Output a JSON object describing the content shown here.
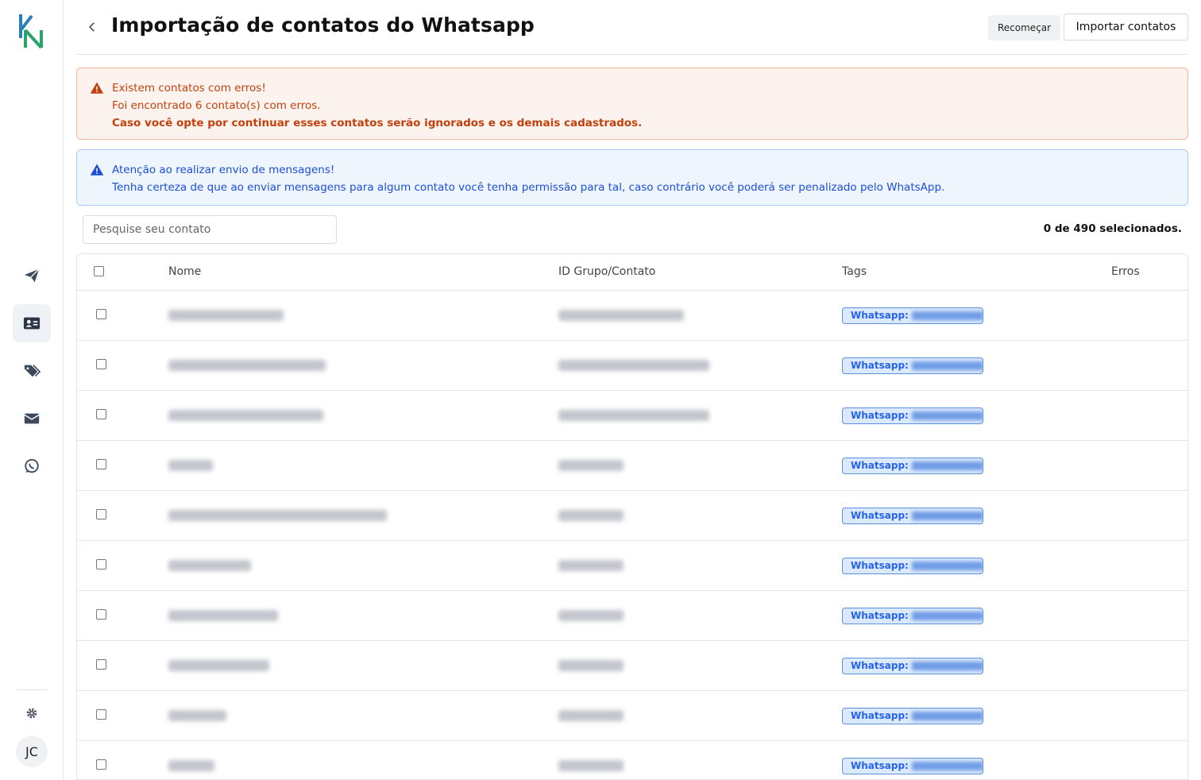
{
  "header": {
    "title": "Importação de contatos do Whatsapp",
    "restart_label": "Recomeçar",
    "import_label": "Importar contatos"
  },
  "alerts": {
    "error": {
      "title": "Existem contatos com erros!",
      "line1": "Foi encontrado 6 contato(s) com erros.",
      "line2": "Caso você opte por continuar esses contatos serão ignorados e os demais cadastrados."
    },
    "info": {
      "title": "Atenção ao realizar envio de mensagens!",
      "line1": "Tenha certeza de que ao enviar mensagens para algum contato você tenha permissão para tal, caso contrário você poderá ser penalizado pelo WhatsApp."
    }
  },
  "search": {
    "placeholder": "Pesquise seu contato"
  },
  "selection": {
    "count_text": "0 de 490 selecionados."
  },
  "table": {
    "columns": [
      "Nome",
      "ID Grupo/Contato",
      "Tags",
      "Erros"
    ],
    "tag_prefix": "Whatsapp:"
  },
  "user": {
    "initials": "JC"
  },
  "colors": {
    "error_bg": "#fdf3ee",
    "error_text": "#c2410c",
    "info_bg": "#eef5fd",
    "info_text": "#1d4ed8",
    "tag_bg": "#dbe9fc",
    "tag_text": "#2563eb"
  },
  "icons": {
    "sidebar": [
      "send-icon",
      "contact-card-icon",
      "tags-icon",
      "mail-icon",
      "whatsapp-icon"
    ],
    "settings": "gear-icon",
    "back": "chevron-left-icon",
    "alert": "warning-triangle-icon"
  }
}
